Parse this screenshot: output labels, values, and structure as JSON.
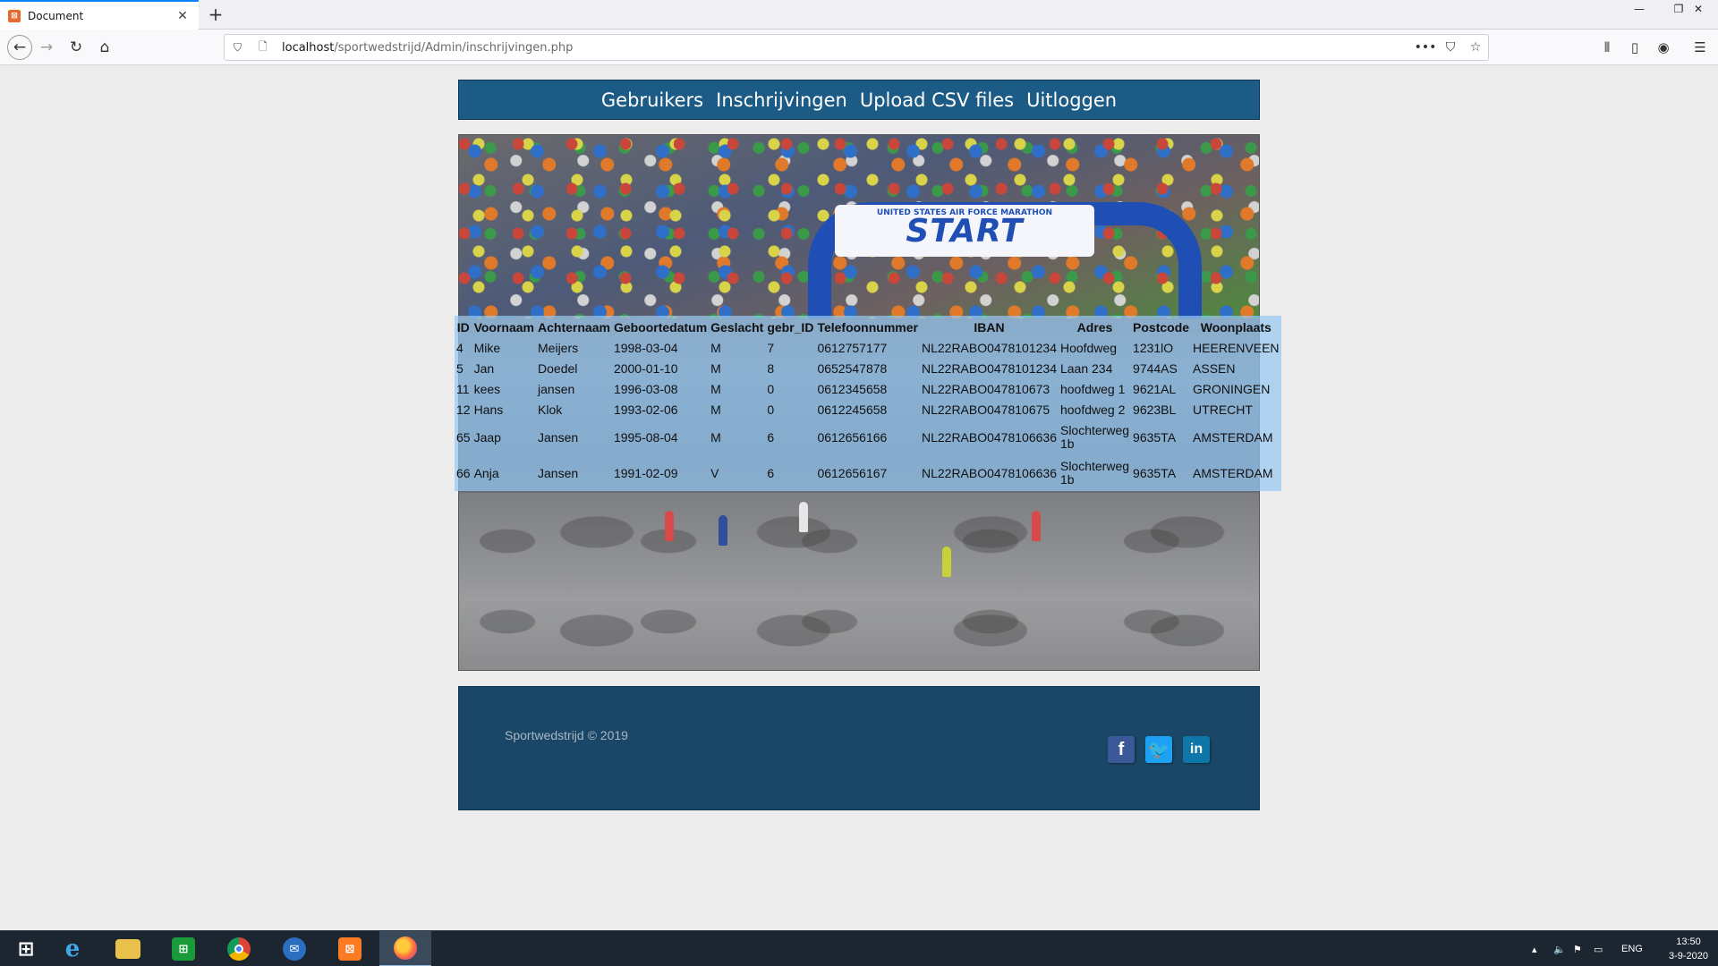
{
  "browser": {
    "tab_title": "Document",
    "tab_favicon": "xampp-icon",
    "new_tab_symbol": "+",
    "url_host": "localhost",
    "url_path": "/sportwedstrijd/Admin/inschrijvingen.php"
  },
  "site_nav": {
    "items": [
      "Gebruikers",
      "Inschrijvingen",
      "Upload CSV files",
      "Uitloggen"
    ]
  },
  "hero": {
    "banner_text": "START",
    "banner_subtext": "UNITED STATES AIR FORCE MARATHON"
  },
  "table": {
    "headers": [
      "ID",
      "Voornaam",
      "Achternaam",
      "Geboortedatum",
      "Geslacht",
      "gebr_ID",
      "Telefoonnummer",
      "IBAN",
      "Adres",
      "Postcode",
      "Woonplaats"
    ],
    "rows": [
      [
        "4",
        "Mike",
        "Meijers",
        "1998-03-04",
        "M",
        "7",
        "0612757177",
        "NL22RABO0478101234",
        "Hoofdweg",
        "1231lO",
        "HEERENVEEN"
      ],
      [
        "5",
        "Jan",
        "Doedel",
        "2000-01-10",
        "M",
        "8",
        "0652547878",
        "NL22RABO0478101234",
        "Laan 234",
        "9744AS",
        "ASSEN"
      ],
      [
        "11",
        "kees",
        "jansen",
        "1996-03-08",
        "M",
        "0",
        "0612345658",
        "NL22RABO047810673",
        "hoofdweg 1",
        "9621AL",
        "GRONINGEN"
      ],
      [
        "12",
        "Hans",
        "Klok",
        "1993-02-06",
        "M",
        "0",
        "0612245658",
        "NL22RABO047810675",
        "hoofdweg 2",
        "9623BL",
        "UTRECHT"
      ],
      [
        "65",
        "Jaap",
        "Jansen",
        "1995-08-04",
        "M",
        "6",
        "0612656166",
        "NL22RABO0478106636",
        "Slochterweg 1b",
        "9635TA",
        "AMSTERDAM"
      ],
      [
        "66",
        "Anja",
        "Jansen",
        "1991-02-09",
        "V",
        "6",
        "0612656167",
        "NL22RABO0478106636",
        "Slochterweg 1b",
        "9635TA",
        "AMSTERDAM"
      ]
    ]
  },
  "footer": {
    "copyright": "Sportwedstrijd © 2019",
    "social": [
      {
        "name": "facebook-icon",
        "glyph": "f",
        "color": "#3b5998"
      },
      {
        "name": "twitter-icon",
        "glyph": "t",
        "color": "#1da1f2"
      },
      {
        "name": "linkedin-icon",
        "glyph": "in",
        "color": "#0e76a8"
      }
    ]
  },
  "taskbar": {
    "language": "ENG",
    "time": "13:50",
    "date": "3-9-2020",
    "apps": [
      "windows-start-icon",
      "internet-explorer-icon",
      "file-explorer-icon",
      "store-icon",
      "chrome-icon",
      "thunderbird-icon",
      "xampp-icon",
      "firefox-icon"
    ]
  },
  "colors": {
    "nav_bg": "#1c5b85",
    "footer_bg": "#1a4767",
    "table_overlay": "#96c8f0"
  }
}
